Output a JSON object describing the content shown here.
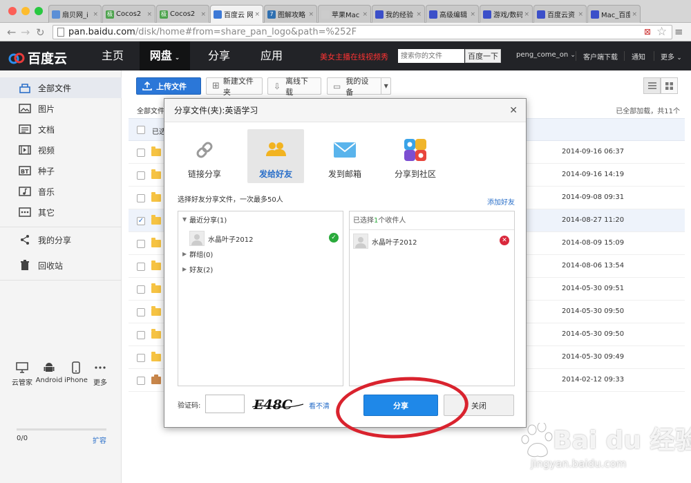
{
  "browser": {
    "tabs": [
      {
        "title": "扇贝网_i",
        "fav_color": "#5b8fd6",
        "fav": ""
      },
      {
        "title": "Cocos2",
        "fav_color": "#4ea34e",
        "fav": "极"
      },
      {
        "title": "Cocos2",
        "fav_color": "#4ea34e",
        "fav": "极"
      },
      {
        "title": "百度云 网",
        "fav_color": "#3d79d6",
        "fav": ""
      },
      {
        "title": "图解攻略",
        "fav_color": "#2f6fb0",
        "fav": "7"
      },
      {
        "title": "苹果Mac",
        "fav_color": "#cccccc",
        "fav": ""
      },
      {
        "title": "我的经验",
        "fav_color": "#3b4fc9",
        "fav": ""
      },
      {
        "title": "高级编辑",
        "fav_color": "#3b4fc9",
        "fav": ""
      },
      {
        "title": "游戏/数码",
        "fav_color": "#3b4fc9",
        "fav": ""
      },
      {
        "title": "百度云资",
        "fav_color": "#3b4fc9",
        "fav": ""
      },
      {
        "title": "Mac_百度",
        "fav_color": "#3b4fc9",
        "fav": ""
      }
    ],
    "url_host": "pan.baidu.com",
    "url_path": "/disk/home#from=share_pan_logo&path=%252F"
  },
  "header": {
    "logo": "百度云",
    "nav": [
      "主页",
      "网盘",
      "分享",
      "应用"
    ],
    "promo": "美女主播在线视频秀",
    "search_placeholder": "搜索你的文件",
    "search_button": "百度一下",
    "user": "peng_come_on",
    "client_download": "客户端下载",
    "notify": "通知",
    "more": "更多"
  },
  "sidebar": {
    "items": [
      "全部文件",
      "图片",
      "文档",
      "视频",
      "种子",
      "音乐",
      "其它"
    ],
    "myshare": "我的分享",
    "recycle": "回收站",
    "devices": [
      "云管家",
      "Android",
      "iPhone",
      "更多"
    ],
    "quota": "0/0",
    "expand": "扩容"
  },
  "toolbar": {
    "upload": "上传文件",
    "newfolder": "新建文件夹",
    "offline": "离线下载",
    "mydevice": "我的设备"
  },
  "files": {
    "breadcrumb": "全部文件",
    "loaded": "已全部加载，共11个",
    "selected_prefix": "已选",
    "dates": [
      "2014-09-16 06:37",
      "2014-09-16 14:19",
      "2014-09-08 09:31",
      "2014-08-27 11:20",
      "2014-08-09 15:09",
      "2014-08-06 13:54",
      "2014-05-30 09:51",
      "2014-05-30 09:50",
      "2014-05-30 09:50",
      "2014-05-30 09:49",
      "2014-02-12 09:33"
    ]
  },
  "dialog": {
    "title": "分享文件(夹):英语学习",
    "tabs": [
      "链接分享",
      "发给好友",
      "发到邮箱",
      "分享到社区"
    ],
    "hint": "选择好友分享文件，一次最多50人",
    "add_friend": "添加好友",
    "recent": "最近分享(1)",
    "friend_name": "水晶叶子2012",
    "groups": "群组(0)",
    "friends": "好友(2)",
    "selected_prefix": "已选择",
    "selected_count": "1",
    "selected_suffix": "个收件人",
    "captcha_label": "验证码:",
    "captcha_text": "E48C",
    "captcha_refresh": "看不清",
    "share_button": "分享",
    "close_button": "关闭"
  },
  "watermark": {
    "brand": "Bai du 经验",
    "url": "jingyan.baidu.com"
  },
  "colors": {
    "header_bg": "#222327",
    "accent_blue": "#1f88e8",
    "annotation_red": "#d9232e",
    "folder_yellow": "#f6c343"
  }
}
